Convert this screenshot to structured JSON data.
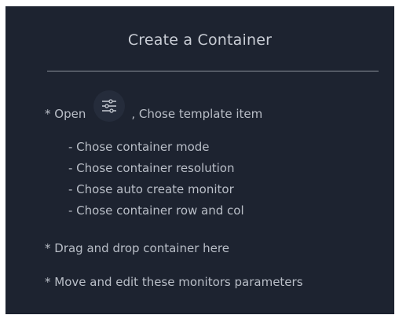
{
  "panel": {
    "title": "Create a Container",
    "open_prefix": "* Open",
    "open_suffix": ", Chose template item",
    "settings_icon": "sliders-icon",
    "sub_steps": [
      "- Chose container mode",
      "- Chose container resolution",
      "- Chose auto create monitor",
      "- Chose container row and col"
    ],
    "drag_drop": "* Drag and drop container here",
    "move_edit": "* Move and edit these monitors parameters"
  },
  "colors": {
    "background": "#1d2330",
    "text": "#b9bec7",
    "divider": "#8c919a"
  }
}
